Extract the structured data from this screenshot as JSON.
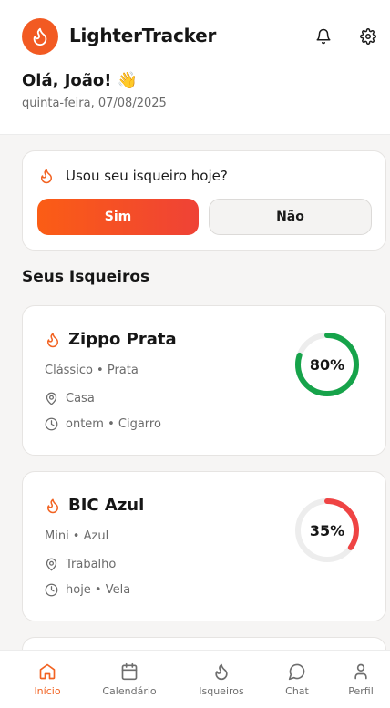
{
  "app": {
    "title": "LighterTracker"
  },
  "greeting": {
    "text": "Olá, João!",
    "emoji": "👋",
    "date": "quinta-feira, 07/08/2025"
  },
  "daily_question": {
    "text": "Usou seu isqueiro hoje?",
    "yes_label": "Sim",
    "no_label": "Não"
  },
  "section": {
    "title": "Seus Isqueiros"
  },
  "lighters": [
    {
      "name": "Zippo Prata",
      "type": "Clássico • Prata",
      "location": "Casa",
      "last_use": "ontem • Cigarro",
      "level_percent": 80,
      "level_label": "80%",
      "gauge_color": "#16a34a"
    },
    {
      "name": "BIC Azul",
      "type": "Mini • Azul",
      "location": "Trabalho",
      "last_use": "hoje • Vela",
      "level_percent": 35,
      "level_label": "35%",
      "gauge_color": "#ef4444"
    }
  ],
  "colors": {
    "accent": "#f26322",
    "green": "#16a34a",
    "red": "#ef4444"
  },
  "icons": {
    "logo": "flame-icon",
    "notifications": "bell-icon",
    "settings": "gear-icon",
    "location": "map-pin-icon",
    "time": "clock-icon"
  },
  "tabs": [
    {
      "label": "Início",
      "icon": "home-icon",
      "active": true
    },
    {
      "label": "Calendário",
      "icon": "calendar-icon",
      "active": false
    },
    {
      "label": "Isqueiros",
      "icon": "flame-icon",
      "active": false
    },
    {
      "label": "Chat",
      "icon": "chat-icon",
      "active": false
    },
    {
      "label": "Perfil",
      "icon": "user-icon",
      "active": false
    }
  ]
}
